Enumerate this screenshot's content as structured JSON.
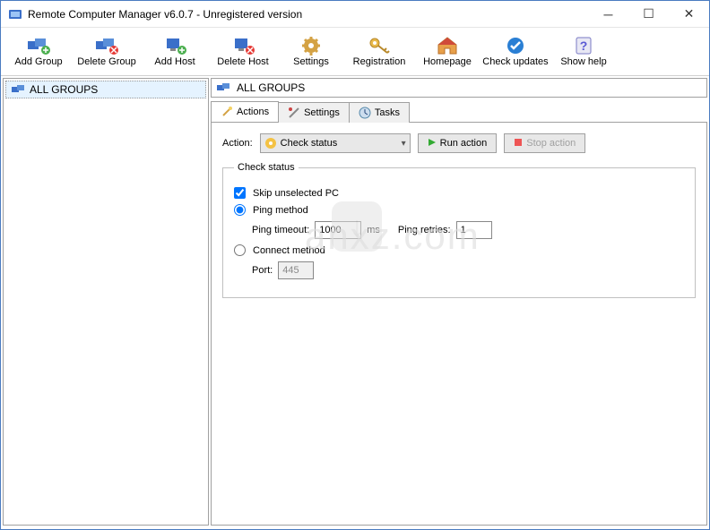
{
  "title": "Remote Computer Manager v6.0.7 - Unregistered version",
  "toolbar": [
    {
      "label": "Add Group"
    },
    {
      "label": "Delete Group"
    },
    {
      "label": "Add Host"
    },
    {
      "label": "Delete Host"
    },
    {
      "label": "Settings"
    },
    {
      "label": "Registration"
    },
    {
      "label": "Homepage"
    },
    {
      "label": "Check updates"
    },
    {
      "label": "Show help"
    }
  ],
  "sidebar": {
    "root": "ALL GROUPS"
  },
  "content_header": "ALL GROUPS",
  "tabs": [
    {
      "label": "Actions"
    },
    {
      "label": "Settings"
    },
    {
      "label": "Tasks"
    }
  ],
  "action": {
    "label": "Action:",
    "selected": "Check status",
    "run": "Run action",
    "stop": "Stop action"
  },
  "fieldset": {
    "legend": "Check status",
    "skip_label": "Skip unselected PC",
    "ping_label": "Ping method",
    "ping_timeout_label": "Ping timeout:",
    "ping_timeout_value": "1000",
    "ping_timeout_unit": "ms",
    "ping_retries_label": "Ping retries:",
    "ping_retries_value": "1",
    "connect_label": "Connect method",
    "port_label": "Port:",
    "port_value": "445"
  },
  "watermark": "anxz.com"
}
